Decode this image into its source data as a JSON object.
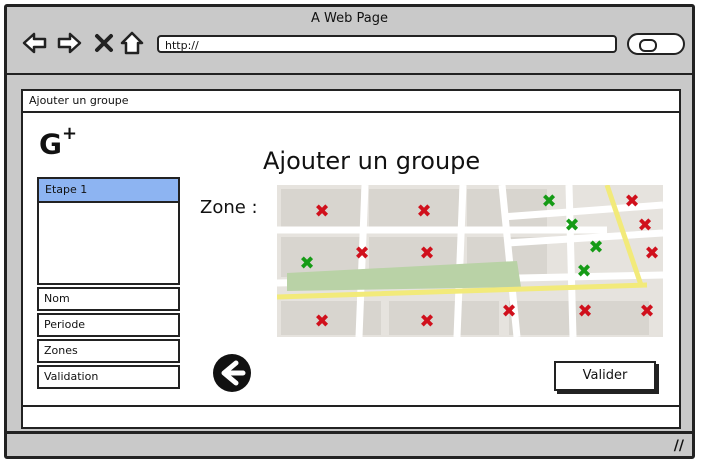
{
  "window": {
    "title": "A Web Page"
  },
  "toolbar": {
    "url": "http://"
  },
  "breadcrumb": "Ajouter un groupe",
  "logo": {
    "text": "G",
    "plus": "+"
  },
  "steps": {
    "selected": "Etape 1",
    "items": [
      "Nom",
      "Periode",
      "Zones",
      "Validation"
    ]
  },
  "main": {
    "heading": "Ajouter un groupe",
    "zone_label": "Zone :",
    "submit": "Valider"
  },
  "map": {
    "markers_red": 14,
    "markers_green": 5
  },
  "colors": {
    "selected": "#8db4f2",
    "red_marker": "#d0101c",
    "green_marker": "#169b16"
  },
  "icons": [
    "back-icon",
    "forward-icon",
    "close-icon",
    "home-icon",
    "search-icon",
    "back-arrow-icon",
    "resize-grip-icon"
  ]
}
